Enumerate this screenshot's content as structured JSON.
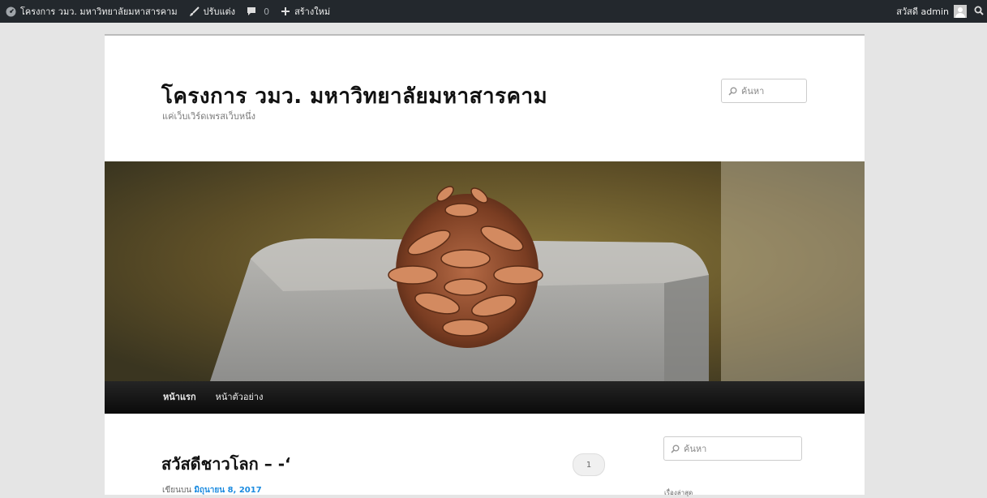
{
  "adminbar": {
    "site_name": "โครงการ วมว. มหาวิทยาลัยมหาสารคาม",
    "customize": "ปรับแต่ง",
    "comments_count": "0",
    "new": "สร้างใหม่",
    "greeting": "สวัสดี admin"
  },
  "site": {
    "title": "โครงการ วมว. มหาวิทยาลัยมหาสารคาม",
    "description": "แค่เว็บเวิร์ดเพรสเว็บหนึ่ง"
  },
  "search": {
    "placeholder": "ค้นหา"
  },
  "nav": {
    "items": [
      "หน้าแรก",
      "หน้าตัวอย่าง"
    ]
  },
  "post": {
    "title": "สวัสดีชาวโลก – -‘",
    "meta_prefix": "เขียนบน",
    "date": "มิถุนายน 8, 2017",
    "comment_count": "1"
  },
  "sidebar": {
    "search_placeholder": "ค้นหา",
    "recent_heading": "เรื่องล่าสุด"
  }
}
